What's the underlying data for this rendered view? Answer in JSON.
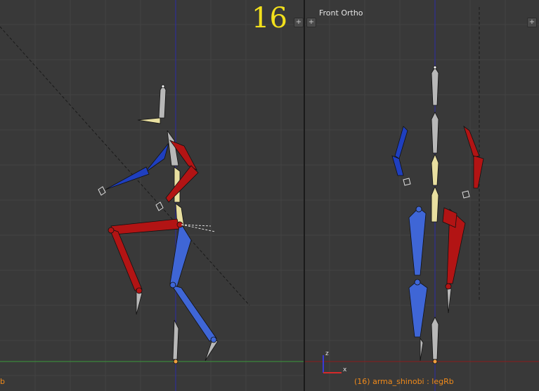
{
  "left_viewport": {
    "frame_number": "16",
    "status_text": "b",
    "toggle_icon": "plus-icon"
  },
  "right_viewport": {
    "view_label": "Front Ortho",
    "status_text": "(16) arma_shinobi : legRb",
    "axis_labels": {
      "z": "z",
      "x": "x"
    },
    "toggle_icon": "plus-icon"
  },
  "colors": {
    "background": "#393939",
    "grid_line": "#424242",
    "axis_x": "#8a1c1c",
    "axis_y": "#3a9a3a",
    "axis_z": "#2a2aa6",
    "frame_number": "#f2e01c",
    "status_text": "#f08a1a",
    "bone_left_side": "#1f3fbf",
    "bone_right_side": "#b21414",
    "bone_center": "#b8b8b8",
    "bone_selected": "#e8dfa0"
  }
}
